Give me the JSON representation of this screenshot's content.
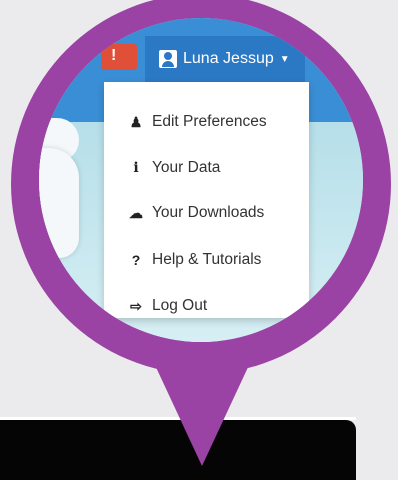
{
  "colors": {
    "background": "#ebebed",
    "pin": "#9a43a4",
    "header_blue": "#3a8ed6",
    "user_tab_blue": "#2b79c4",
    "badge_red": "#e05038"
  },
  "header": {
    "user_name": "Luna Jessup",
    "badge_text": "!"
  },
  "menu": {
    "items": [
      {
        "label": "Edit Preferences",
        "icon": "user-icon",
        "glyph": "♟"
      },
      {
        "label": "Your Data",
        "icon": "info-icon",
        "glyph": "i"
      },
      {
        "label": "Your Downloads",
        "icon": "cloud-download-icon",
        "glyph": "☁"
      },
      {
        "label": "Help & Tutorials",
        "icon": "question-icon",
        "glyph": "?"
      },
      {
        "label": "Log Out",
        "icon": "sign-out-icon",
        "glyph": "⇨"
      }
    ]
  }
}
